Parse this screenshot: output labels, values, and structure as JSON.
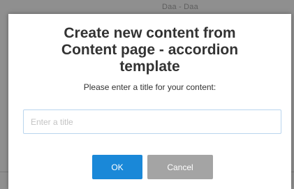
{
  "background": {
    "header_text": "Daa - Daa"
  },
  "dialog": {
    "title": "Create new content from\nContent page - accordion\ntemplate",
    "prompt": "Please enter a title for your content:",
    "title_input": {
      "value": "",
      "placeholder": "Enter a title"
    },
    "ok_label": "OK",
    "cancel_label": "Cancel"
  },
  "colors": {
    "ok_button": "#1a88d8",
    "cancel_button": "#a4a4a4",
    "input_border": "#b9d5ee"
  }
}
